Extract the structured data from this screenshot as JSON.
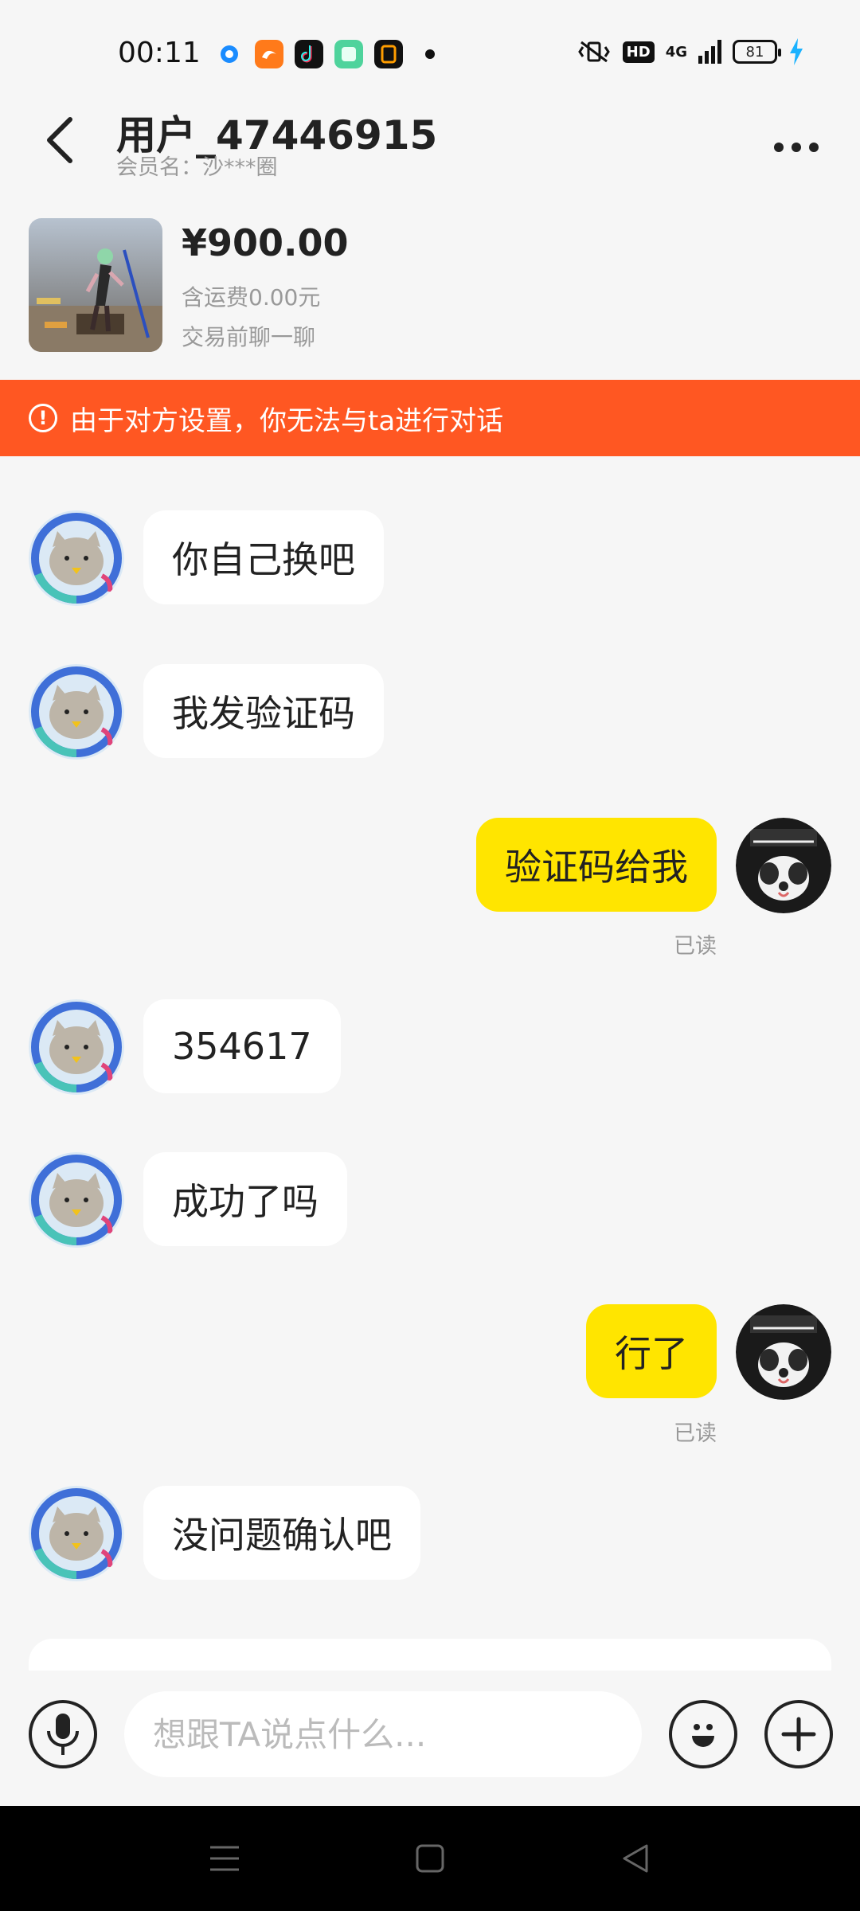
{
  "status_bar": {
    "time": "00:11",
    "network": "4G",
    "battery": "81",
    "hd": "HD",
    "icons": [
      "location-dot-icon",
      "uc-browser-icon",
      "tiktok-icon",
      "green-app-icon",
      "orange-app-icon"
    ]
  },
  "header": {
    "title": "用户_47446915",
    "subtitle": "会员名：沙***圈"
  },
  "product": {
    "price": "¥900.00",
    "shipping": "含运费0.00元",
    "chat_tip": "交易前聊一聊"
  },
  "warning": {
    "text": "由于对方设置，你无法与ta进行对话"
  },
  "messages": [
    {
      "side": "in",
      "text": "你自己换吧"
    },
    {
      "side": "in",
      "text": "我发验证码"
    },
    {
      "side": "out",
      "text": "验证码给我",
      "status": "已读"
    },
    {
      "side": "in",
      "text": "354617"
    },
    {
      "side": "in",
      "text": "成功了吗"
    },
    {
      "side": "out",
      "text": "行了",
      "status": "已读"
    },
    {
      "side": "in",
      "text": "没问题确认吧"
    }
  ],
  "input": {
    "placeholder": "想跟TA说点什么..."
  },
  "colors": {
    "warning_bg": "#ff5722",
    "outgoing_bubble": "#ffe500",
    "incoming_bubble": "#ffffff",
    "background": "#f6f6f6"
  }
}
